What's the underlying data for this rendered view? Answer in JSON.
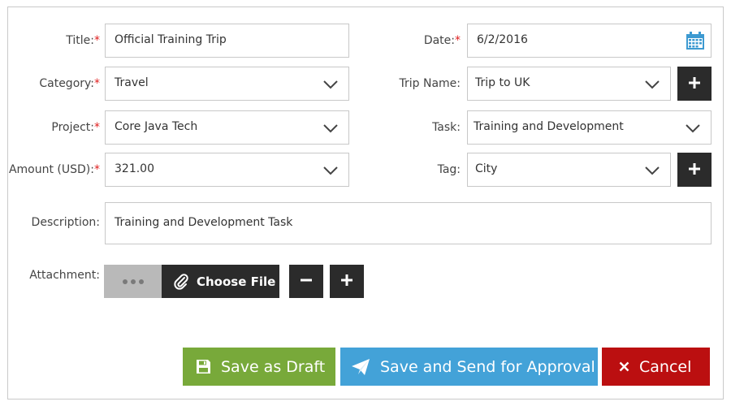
{
  "form": {
    "title": {
      "label": "Title:",
      "required": "*",
      "value": "Official Training Trip"
    },
    "date": {
      "label": "Date:",
      "required": "*",
      "value": "6/2/2016",
      "icon": "calendar-icon"
    },
    "category": {
      "label": "Category:",
      "required": "*",
      "value": "Travel"
    },
    "trip_name": {
      "label": "Trip Name:",
      "value": "Trip to UK"
    },
    "project": {
      "label": "Project:",
      "required": "*",
      "value": "Core Java Tech"
    },
    "task": {
      "label": "Task:",
      "value": "Training and Development"
    },
    "amount": {
      "label": "Amount (USD):",
      "required": "*",
      "value": "321.00"
    },
    "tag": {
      "label": "Tag:",
      "value": "City"
    },
    "description": {
      "label": "Description:",
      "value": "Training and Development Task"
    },
    "attachment": {
      "label": "Attachment:",
      "choose_label": "Choose File"
    }
  },
  "actions": {
    "save_draft": {
      "label": "Save as Draft",
      "color": "#78a93a",
      "icon": "floppy-disk-icon"
    },
    "send_approval": {
      "label": "Save and Send for Approval",
      "color": "#43a2d8",
      "icon": "paper-plane-icon"
    },
    "cancel": {
      "label": "Cancel",
      "color": "#bb0f10",
      "icon": "close-icon"
    }
  },
  "colors": {
    "required": "#e02020",
    "dark_button": "#2b2b2b",
    "border": "#c8c8c8",
    "calendar": "#3d9ad1"
  }
}
